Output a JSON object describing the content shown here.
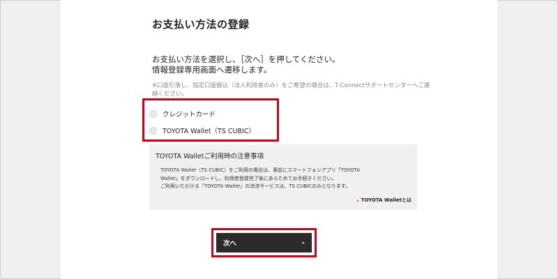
{
  "page": {
    "title": "お支払い方法の登録",
    "intro_line1": "お支払い方法を選択し、［次へ］を押してください。",
    "intro_line2": "情報登録専用画面へ遷移します。",
    "note": "※口座引落し、指定口座振込（法人利用者のみ）をご希望の場合は、T-Connectサポートセンターへご連絡ください。"
  },
  "payment_options": [
    {
      "label": "クレジットカード",
      "selected": false
    },
    {
      "label": "TOYOTA Wallet（TS CUBIC）",
      "selected": false
    }
  ],
  "notice": {
    "title": "TOYOTA Walletご利用時の注意事項",
    "line1": "TOYOTA Wallet（TS CUBIC）をご利用の場合は、事前にスマートフォンアプリ「TOYOTA",
    "line2": "Wallet」をダウンロードし、利用者登録完了後にあらためてお手続きください。",
    "line3": "ご利用いただける「TOYOTA Wallet」の決済サービスは、TS CUBICのみとなります。",
    "link_label": "TOYOTA Walletとは"
  },
  "next_button": {
    "label": "次へ",
    "arrow": "▸"
  },
  "colors": {
    "highlight": "#d0021b",
    "button": "#2b2b2b",
    "notice_bg": "#f0f0f0"
  }
}
